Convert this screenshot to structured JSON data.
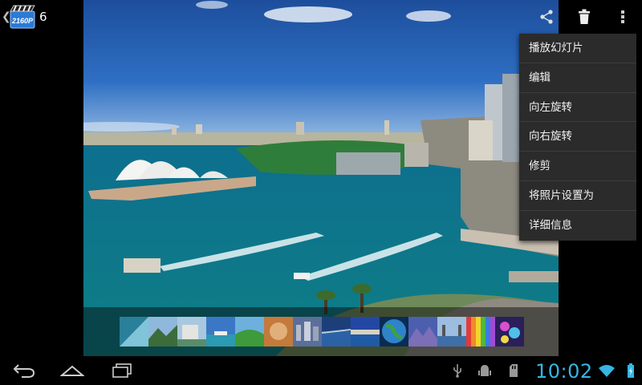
{
  "action_bar": {
    "app_icon_text": "2160P",
    "album_count": "6",
    "up_icon": "chevron-left-icon",
    "share_icon": "share-icon",
    "delete_icon": "trash-icon",
    "overflow_icon": "overflow-menu-icon"
  },
  "popup_menu": {
    "items": [
      {
        "label": "播放幻灯片"
      },
      {
        "label": "编辑"
      },
      {
        "label": "向左旋转"
      },
      {
        "label": "向右旋转"
      },
      {
        "label": "修剪"
      },
      {
        "label": "将照片设置为"
      },
      {
        "label": "详细信息"
      }
    ]
  },
  "photo": {
    "subject": "photo-harbour"
  },
  "filmstrip": {
    "thumb_count": 14
  },
  "system_bar": {
    "clock": "10:02",
    "back_icon": "back-icon",
    "home_icon": "home-icon",
    "recents_icon": "recent-apps-icon",
    "status_icons": [
      "usb-icon",
      "debug-icon",
      "sd-card-icon",
      "wifi-icon",
      "battery-icon"
    ],
    "accent": "#35b6e5"
  }
}
